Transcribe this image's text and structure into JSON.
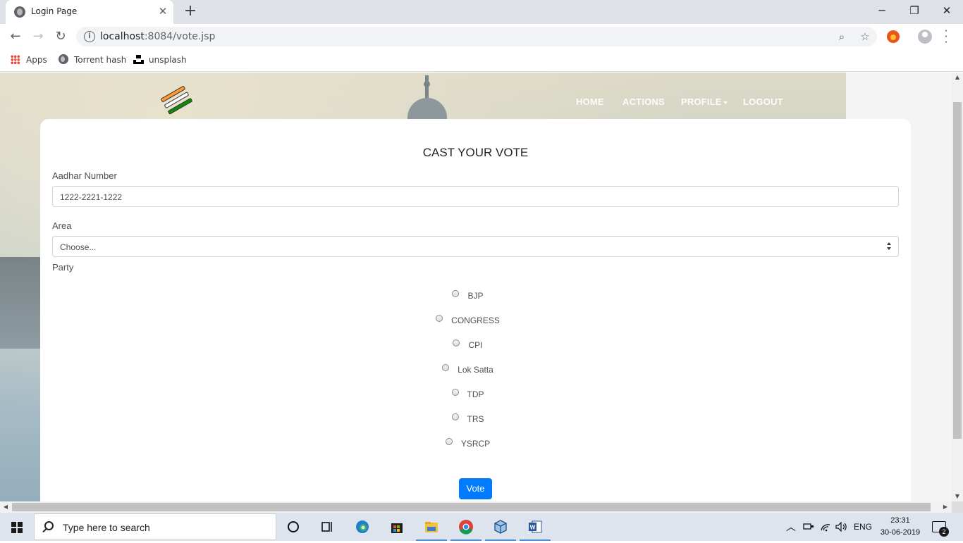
{
  "browser": {
    "tab_title": "Login Page",
    "tab_close": "✕",
    "new_tab": "+",
    "window_controls": {
      "minimize": "─",
      "maximize": "❐",
      "close": "✕"
    },
    "url_host": "localhost",
    "url_path": ":8084/vote.jsp",
    "bookmarks": [
      {
        "label": "Apps",
        "icon": "apps-grid-icon"
      },
      {
        "label": "Torrent hash",
        "icon": "globe-icon"
      },
      {
        "label": "unsplash",
        "icon": "unsplash-icon"
      }
    ]
  },
  "navbar": {
    "items": [
      "HOME",
      "ACTIONS",
      "PROFILE",
      "LOGOUT"
    ],
    "logo": "voting-machine-logo"
  },
  "form": {
    "title": "CAST YOUR VOTE",
    "aadhar_label": "Aadhar Number",
    "aadhar_value": "1222-2221-1222",
    "area_label": "Area",
    "area_selected": "Choose...",
    "party_label": "Party",
    "parties": [
      "BJP",
      "CONGRESS",
      "CPI",
      "Lok Satta",
      "TDP",
      "TRS",
      "YSRCP"
    ],
    "submit_label": "Vote"
  },
  "taskbar": {
    "search_placeholder": "Type here to search",
    "language": "ENG",
    "time": "23:31",
    "date": "30-06-2019",
    "notification_count": "2"
  },
  "colors": {
    "primary_button": "#007bff",
    "tab_strip": "#dee1e6",
    "taskbar": "#dde4ee"
  }
}
